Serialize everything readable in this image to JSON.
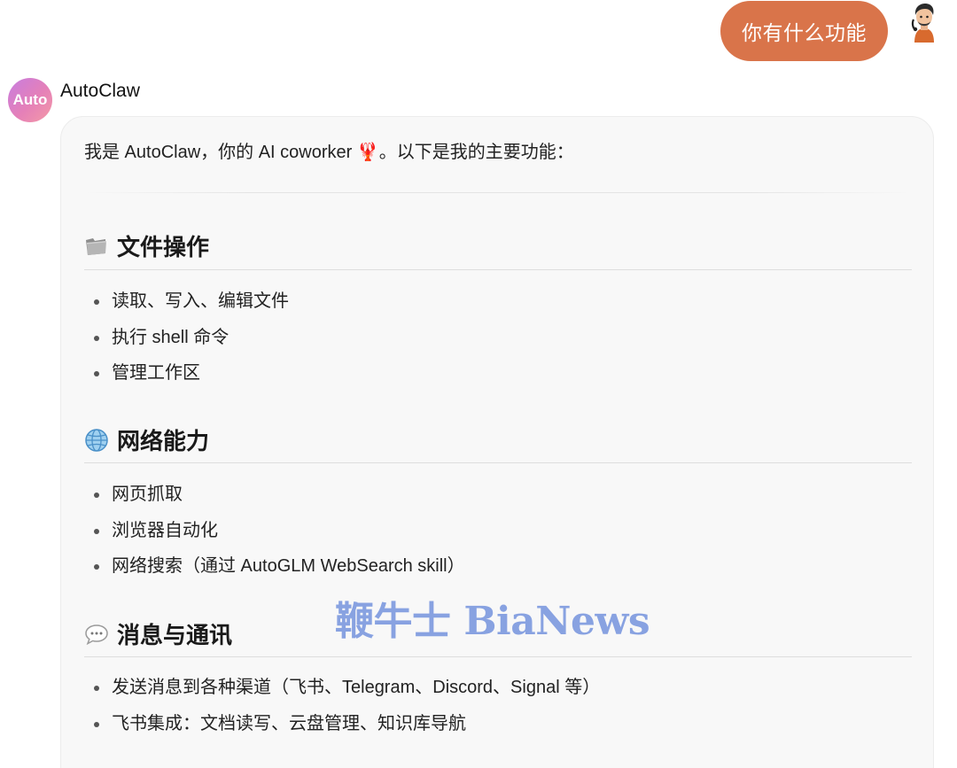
{
  "user_message": {
    "text": "你有什么功能"
  },
  "assistant": {
    "avatar_label": "Auto",
    "name": "AutoClaw",
    "intro": "我是 AutoClaw，你的 AI coworker 🦞。以下是我的主要功能：",
    "sections": [
      {
        "icon": "folder-icon",
        "title": "文件操作",
        "items": [
          "读取、写入、编辑文件",
          "执行 shell 命令",
          "管理工作区"
        ]
      },
      {
        "icon": "globe-icon",
        "title": "网络能力",
        "items": [
          "网页抓取",
          "浏览器自动化",
          "网络搜索（通过 AutoGLM WebSearch skill）"
        ]
      },
      {
        "icon": "speech-bubble-icon",
        "title": "消息与通讯",
        "items": [
          "发送消息到各种渠道（飞书、Telegram、Discord、Signal 等）",
          "飞书集成：文档读写、云盘管理、知识库导航"
        ]
      }
    ]
  },
  "watermark": "鞭牛士 BiaNews",
  "colors": {
    "user_bubble": "#d9744a",
    "card_background": "#f8f8f8",
    "watermark": "#7f9be0"
  }
}
